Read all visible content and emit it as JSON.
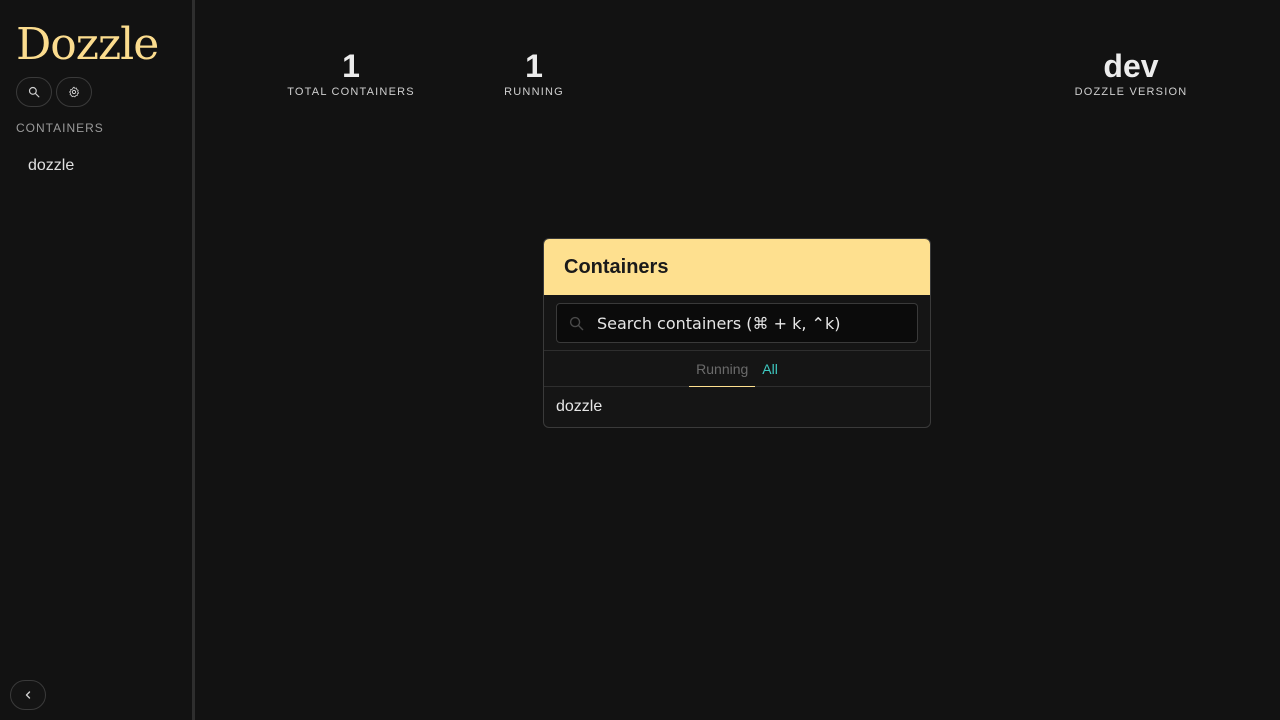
{
  "sidebar": {
    "logo": "Dozzle",
    "section_title": "CONTAINERS",
    "items": [
      {
        "label": "dozzle"
      }
    ],
    "search_icon": "search-icon",
    "settings_icon": "gear-icon",
    "collapse_icon": "chevron-left-icon"
  },
  "stats": [
    {
      "value": "1",
      "label": "TOTAL CONTAINERS"
    },
    {
      "value": "1",
      "label": "RUNNING"
    },
    {
      "value": "dev",
      "label": "DOZZLE VERSION"
    }
  ],
  "panel": {
    "title": "Containers",
    "search_placeholder": "Search containers (⌘ + k, ⌃k)",
    "tabs": [
      {
        "label": "Running",
        "active": true
      },
      {
        "label": "All",
        "active": false
      }
    ],
    "results": [
      {
        "label": "dozzle"
      }
    ]
  },
  "colors": {
    "background": "#121212",
    "accent": "#fee08f",
    "logo": "#fbdc8e",
    "link": "#3ec8c0"
  }
}
